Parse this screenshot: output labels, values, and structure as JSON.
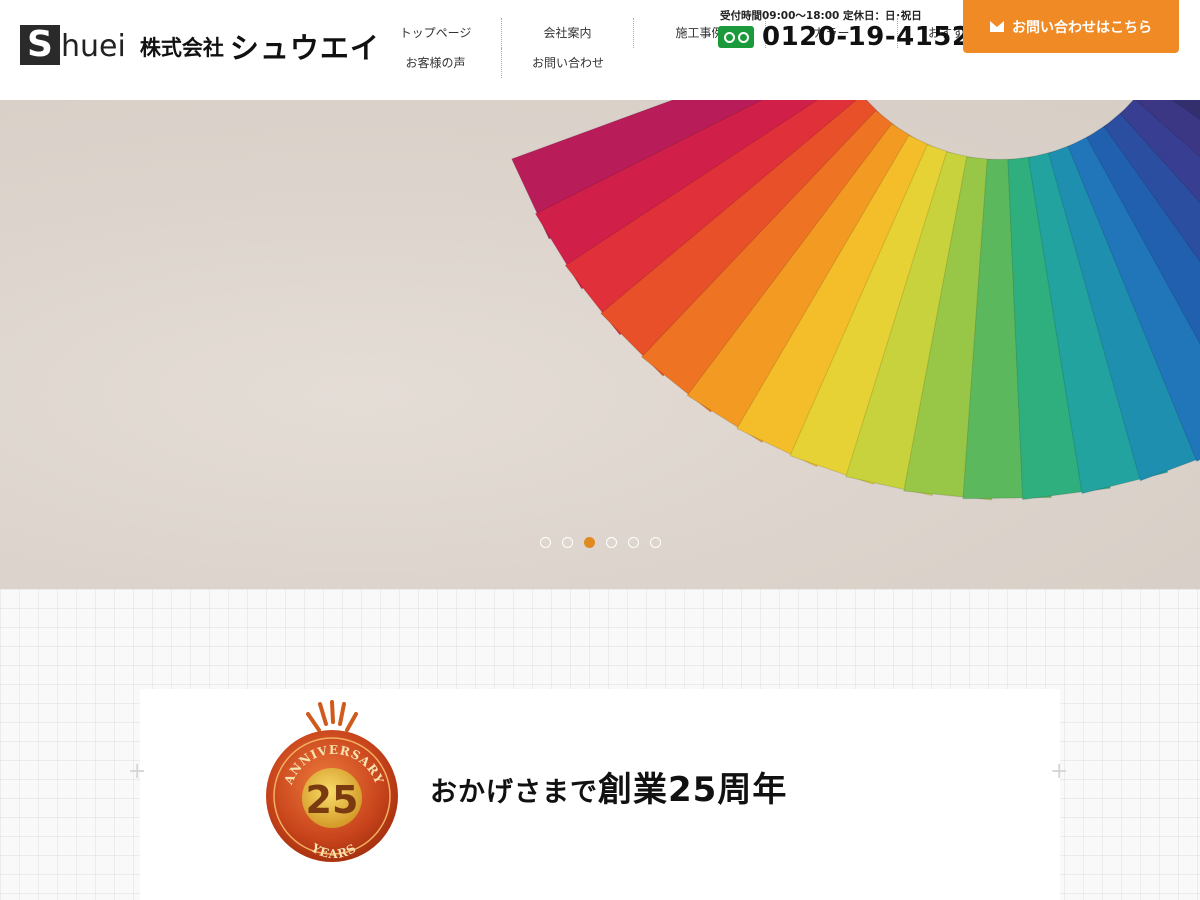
{
  "header": {
    "logo": {
      "initial": "S",
      "rest": "huei",
      "kabushiki": "株式会社",
      "name": "シュウエイ"
    },
    "nav": {
      "row1": [
        "トップページ",
        "会社案内",
        "施工事例",
        "カラー",
        "おすすめ塗料"
      ],
      "row2": [
        "お客様の声",
        "お問い合わせ"
      ]
    },
    "hours": "受付時間09:00～18:00 定休日：日･祝日",
    "phone_icon": "freedial-icon",
    "phone": "0120-19-4152",
    "contact_button": {
      "label": "お問い合わせはこちら",
      "icon": "mail-icon",
      "color": "#ef8a25"
    }
  },
  "hero": {
    "slide_count": 6,
    "active_slide": 3,
    "accent": "#e08a20"
  },
  "anniversary": {
    "badge": {
      "top": "ANNIVERSARY",
      "number": "25",
      "bottom": "YEARS"
    },
    "text_pre": "おかげさまで",
    "text_main": "創業25周年"
  }
}
